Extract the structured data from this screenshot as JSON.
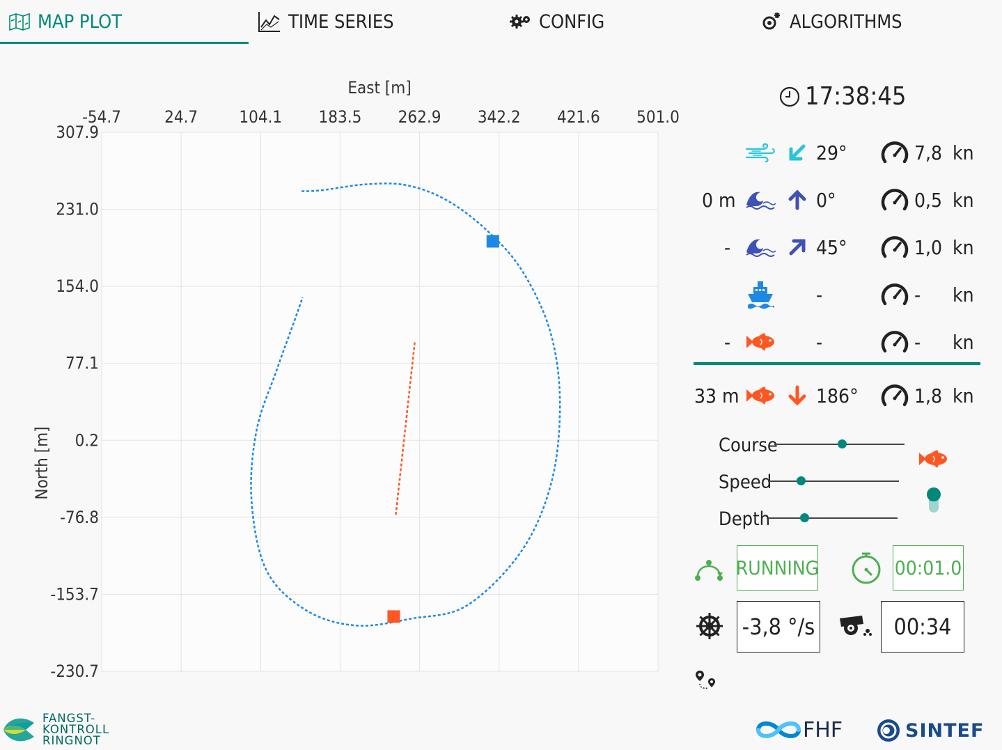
{
  "tabs": [
    {
      "label": "MAP PLOT",
      "icon": "map-icon",
      "active": true
    },
    {
      "label": "TIME SERIES",
      "icon": "chart-line-icon",
      "active": false
    },
    {
      "label": "CONFIG",
      "icon": "gears-icon",
      "active": false
    },
    {
      "label": "ALGORITHMS",
      "icon": "cog-spark-icon",
      "active": false
    }
  ],
  "plot": {
    "xlabel": "East [m]",
    "ylabel": "North [m]",
    "xticks": [
      "-54.7",
      "24.7",
      "104.1",
      "183.5",
      "262.9",
      "342.2",
      "421.6",
      "501.0"
    ],
    "yticks": [
      "307.9",
      "231.0",
      "154.0",
      "77.1",
      "0.2",
      "-76.8",
      "-153.7",
      "-230.7"
    ],
    "colors": {
      "vessel": "#1e88e5",
      "fish": "#ff5722",
      "grid": "#e3e3e3"
    }
  },
  "chart_data": {
    "type": "scatter",
    "xlabel": "East [m]",
    "ylabel": "North [m]",
    "xlim": [
      -54.7,
      501.0
    ],
    "ylim": [
      -230.7,
      307.9
    ],
    "series": [
      {
        "style": "dashed",
        "color": "#1e88e5",
        "points": [
          [
            145,
            249
          ],
          [
            165,
            250
          ],
          [
            210,
            256
          ],
          [
            250,
            255
          ],
          [
            290,
            240
          ],
          [
            330,
            210
          ],
          [
            365,
            170
          ],
          [
            393,
            110
          ],
          [
            403,
            40
          ],
          [
            395,
            -40
          ],
          [
            365,
            -110
          ],
          [
            310,
            -165
          ],
          [
            255,
            -178
          ],
          [
            200,
            -185
          ],
          [
            150,
            -170
          ],
          [
            110,
            -130
          ],
          [
            95,
            -60
          ],
          [
            100,
            10
          ],
          [
            120,
            70
          ],
          [
            138,
            120
          ],
          [
            146,
            143
          ]
        ]
      },
      {
        "style": "dashed",
        "color": "#ff5722",
        "points": [
          [
            258,
            98
          ],
          [
            239,
            -75
          ]
        ]
      }
    ],
    "markers": [
      {
        "x": 336,
        "y": 199,
        "color": "#1e88e5",
        "shape": "square"
      },
      {
        "x": 237,
        "y": -176,
        "color": "#ff5722",
        "shape": "square"
      }
    ]
  },
  "clock": "17:38:45",
  "env": [
    {
      "prefix": "",
      "icon": "wind-icon",
      "dir_icon": "arrow-down-left-icon",
      "dir": "29°",
      "speed": "7,8",
      "unit": "kn"
    },
    {
      "prefix": "0 m",
      "icon": "current-icon",
      "dir_icon": "arrow-up-icon",
      "dir": "0°",
      "speed": "0,5",
      "unit": "kn"
    },
    {
      "prefix": "-",
      "icon": "current-icon",
      "dir_icon": "arrow-up-right-icon",
      "dir": "45°",
      "speed": "1,0",
      "unit": "kn"
    },
    {
      "prefix": "",
      "icon": "ship-icon",
      "dir_icon": "",
      "dir": "-",
      "speed": "-",
      "unit": "kn"
    },
    {
      "prefix": "-",
      "icon": "fish-icon",
      "dir_icon": "",
      "dir": "-",
      "speed": "-",
      "unit": "kn"
    }
  ],
  "fish_row": {
    "prefix": "33 m",
    "icon": "fish-icon",
    "dir_icon": "arrow-down-icon",
    "dir": "186°",
    "speed": "1,8",
    "unit": "kn"
  },
  "sliders": [
    {
      "label": "Course",
      "value": 0.52
    },
    {
      "label": "Speed",
      "value": 0.25
    },
    {
      "label": "Depth",
      "value": 0.29
    }
  ],
  "status": {
    "state": "RUNNING",
    "timer": "00:01.0",
    "rot": "-3,8 °/s",
    "countdown": "00:34"
  },
  "logos": {
    "left": [
      "FANGST-",
      "KONTROLL",
      "RINGNOT"
    ],
    "fhf": "FHF",
    "sintef": "SINTEF"
  }
}
